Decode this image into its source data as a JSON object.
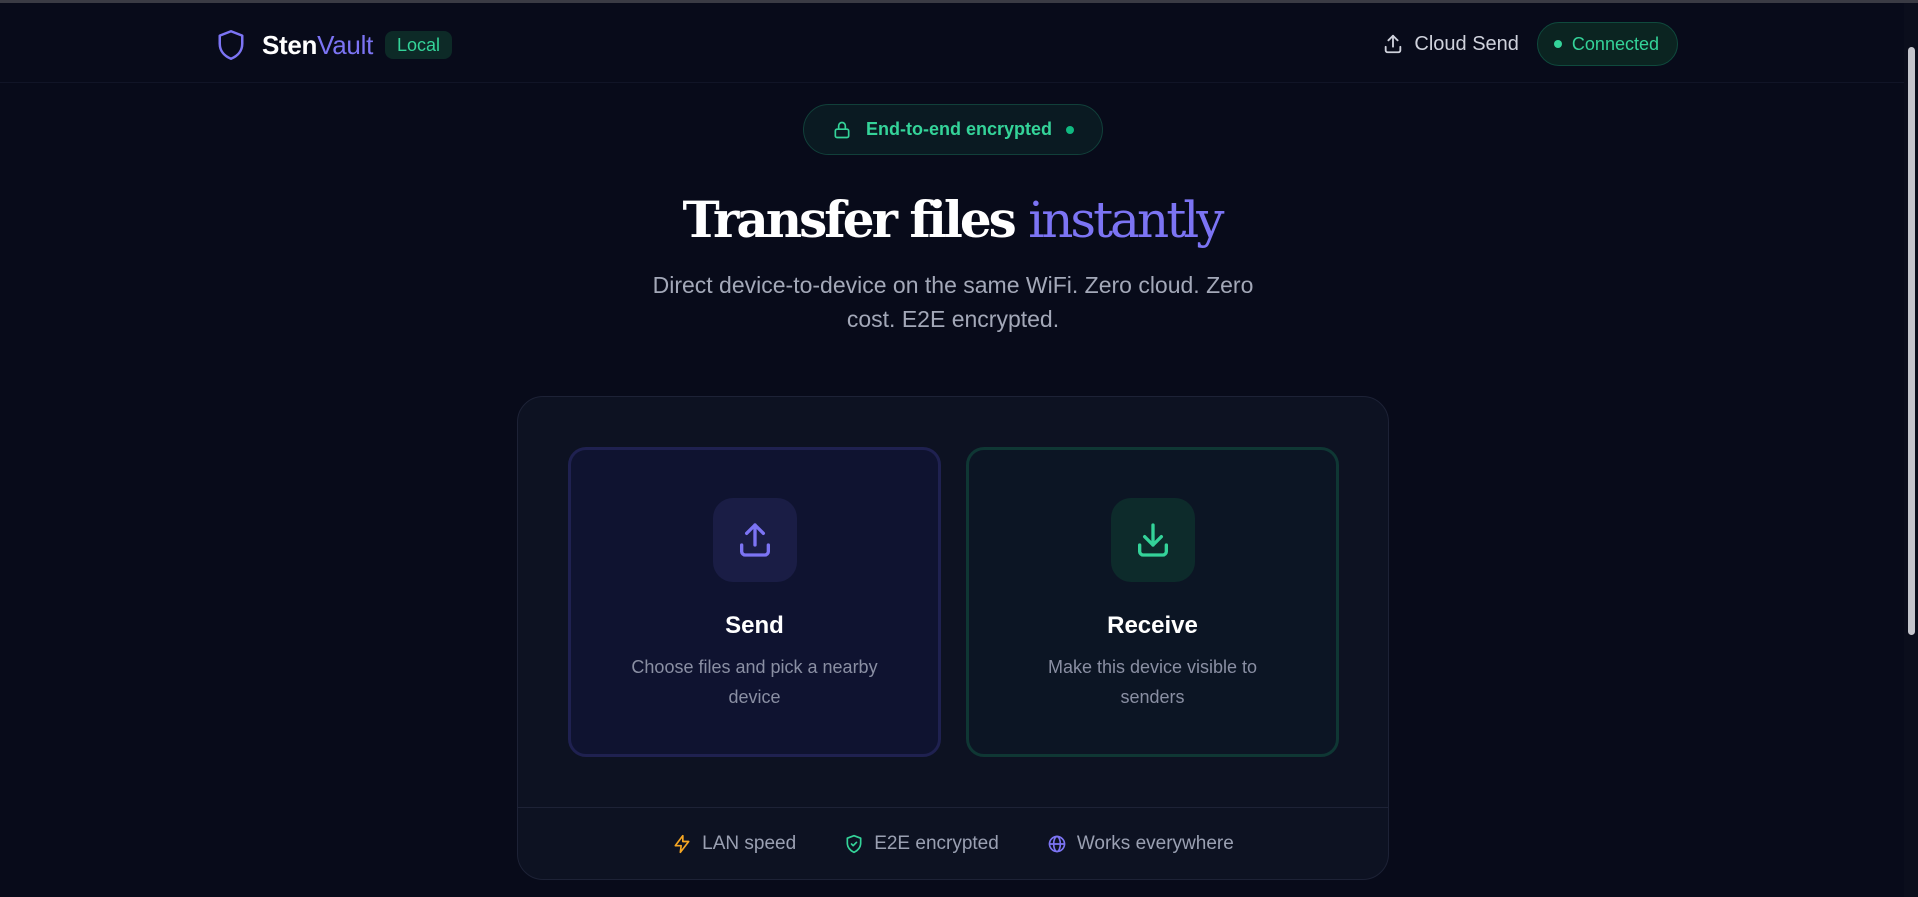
{
  "brand": {
    "name_part1": "Sten",
    "name_part2": "Vault",
    "badge": "Local",
    "accent": "#7c74f4",
    "green": "#34d399"
  },
  "header": {
    "cloud_send_label": "Cloud Send",
    "status_label": "Connected"
  },
  "encryption_pill": {
    "label": "End-to-end encrypted"
  },
  "hero": {
    "title_part1": "Transfer files",
    "title_part2": "instantly",
    "subtitle": "Direct device-to-device on the same WiFi. Zero cloud. Zero cost. E2E encrypted."
  },
  "cards": {
    "send": {
      "title": "Send",
      "description": "Choose files and pick a nearby device",
      "icon": "upload-icon"
    },
    "receive": {
      "title": "Receive",
      "description": "Make this device visible to senders",
      "icon": "download-icon"
    }
  },
  "features": [
    {
      "label": "LAN speed",
      "icon": "lightning-icon",
      "color": "#f5a623"
    },
    {
      "label": "E2E encrypted",
      "icon": "shield-check-icon",
      "color": "#34d399"
    },
    {
      "label": "Works everywhere",
      "icon": "globe-icon",
      "color": "#7c74f4"
    }
  ]
}
